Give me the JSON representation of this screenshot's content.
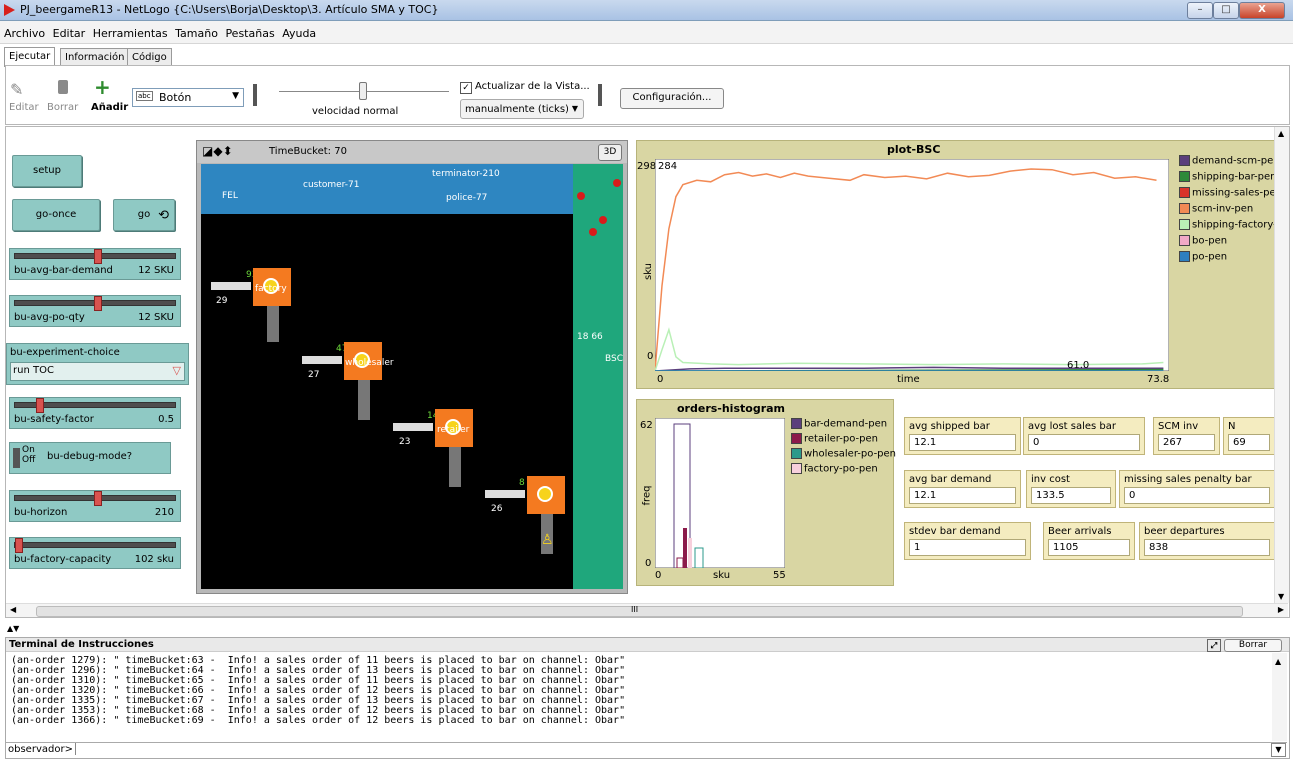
{
  "window": {
    "title": "PJ_beergameR13 - NetLogo {C:\\Users\\Borja\\Desktop\\3. Artículo SMA y TOC}",
    "min": "–",
    "max": "□",
    "close": "X"
  },
  "menu": [
    "Archivo",
    "Editar",
    "Herramientas",
    "Tamaño",
    "Pestañas",
    "Ayuda"
  ],
  "tabs": [
    "Ejecutar",
    "Información",
    "Código"
  ],
  "toolbar": {
    "edit": "Editar",
    "delete": "Borrar",
    "add": "Añadir",
    "widget_type": "Botón",
    "widget_prefix": "abc",
    "speed_label": "velocidad normal",
    "update_check": "Actualizar de la Vista...",
    "update_mode": "manualmente (ticks)",
    "settings": "Configuración..."
  },
  "buttons": {
    "setup": "setup",
    "go_once": "go-once",
    "go": "go"
  },
  "sliders": [
    {
      "name": "bu-avg-bar-demand",
      "value": "12 SKU",
      "pos": 0.5
    },
    {
      "name": "bu-avg-po-qty",
      "value": "12 SKU",
      "pos": 0.5
    },
    {
      "name": "bu-safety-factor",
      "value": "0.5",
      "pos": 0.15
    },
    {
      "name": "bu-horizon",
      "value": "210",
      "pos": 0.5
    },
    {
      "name": "bu-factory-capacity",
      "value": "102 sku",
      "pos": 0.02
    }
  ],
  "chooser": {
    "label": "bu-experiment-choice",
    "value": "run TOC"
  },
  "switch": {
    "label": "bu-debug-mode?",
    "on": "On",
    "off": "Off"
  },
  "view": {
    "title": "TimeBucket: 70",
    "btn3d": "3D",
    "labels": {
      "fel": "FEL",
      "terminator": "terminator-210",
      "police": "police-77",
      "customer": "customer-71",
      "bsc": "BSC",
      "n93": "93",
      "n29": "29",
      "n47": "47",
      "n27": "27",
      "n14": "14",
      "n23": "23",
      "n8": "8",
      "n26": "26",
      "n18": "18 66",
      "r0": "0",
      "factory": "factory",
      "wholesaler": "wholesaler",
      "retailer": "retailer"
    }
  },
  "plot": {
    "title": "plot-BSC",
    "ymax": "298",
    "ylabel": "sku",
    "xlabel": "time",
    "xmin": "0",
    "xmax": "73.8",
    "ymin": "0",
    "peak_label": "284",
    "end_label": "61.0",
    "legend": [
      {
        "name": "demand-scm-pen",
        "color": "#5b3f7c"
      },
      {
        "name": "shipping-bar-pen",
        "color": "#2e8a3a"
      },
      {
        "name": "missing-sales-pen",
        "color": "#d9342b"
      },
      {
        "name": "scm-inv-pen",
        "color": "#f28a55"
      },
      {
        "name": "shipping-factory-pen",
        "color": "#b9f0b6"
      },
      {
        "name": "bo-pen",
        "color": "#f1a9c7"
      },
      {
        "name": "po-pen",
        "color": "#2d7fc0"
      }
    ]
  },
  "histogram": {
    "title": "orders-histogram",
    "ymax": "62",
    "ymin": "0",
    "ylabel": "freq",
    "xlabel": "sku",
    "xmin": "0",
    "xmax": "55",
    "legend": [
      {
        "name": "bar-demand-pen",
        "color": "#5b3f7c"
      },
      {
        "name": "retailer-po-pen",
        "color": "#8b1a4a"
      },
      {
        "name": "wholesaler-po-pen",
        "color": "#2b9a8b"
      },
      {
        "name": "factory-po-pen",
        "color": "#f7d0dc"
      }
    ]
  },
  "monitors": [
    {
      "label": "avg shipped bar",
      "value": "12.1"
    },
    {
      "label": "avg lost sales bar",
      "value": "0"
    },
    {
      "label": "SCM inv",
      "value": "267"
    },
    {
      "label": "N",
      "value": "69"
    },
    {
      "label": "avg bar demand",
      "value": "12.1"
    },
    {
      "label": "inv cost",
      "value": "133.5"
    },
    {
      "label": "missing sales penalty bar",
      "value": "0"
    },
    {
      "label": "stdev bar demand",
      "value": "1"
    },
    {
      "label": "Beer arrivals",
      "value": "1105"
    },
    {
      "label": "beer departures",
      "value": "838"
    }
  ],
  "terminal": {
    "title": "Terminal de Instrucciones",
    "clear": "Borrar",
    "prompt": "observador>",
    "lines": [
      "(an-order 1279): \" timeBucket:63 -  Info! a sales order of 11 beers is placed to bar on channel: Obar\"",
      "(an-order 1296): \" timeBucket:64 -  Info! a sales order of 13 beers is placed to bar on channel: Obar\"",
      "(an-order 1310): \" timeBucket:65 -  Info! a sales order of 11 beers is placed to bar on channel: Obar\"",
      "(an-order 1320): \" timeBucket:66 -  Info! a sales order of 12 beers is placed to bar on channel: Obar\"",
      "(an-order 1335): \" timeBucket:67 -  Info! a sales order of 13 beers is placed to bar on channel: Obar\"",
      "(an-order 1353): \" timeBucket:68 -  Info! a sales order of 12 beers is placed to bar on channel: Obar\"",
      "(an-order 1366): \" timeBucket:69 -  Info! a sales order of 12 beers is placed to bar on channel: Obar\""
    ]
  },
  "scrollbar": {
    "mid": "III"
  }
}
